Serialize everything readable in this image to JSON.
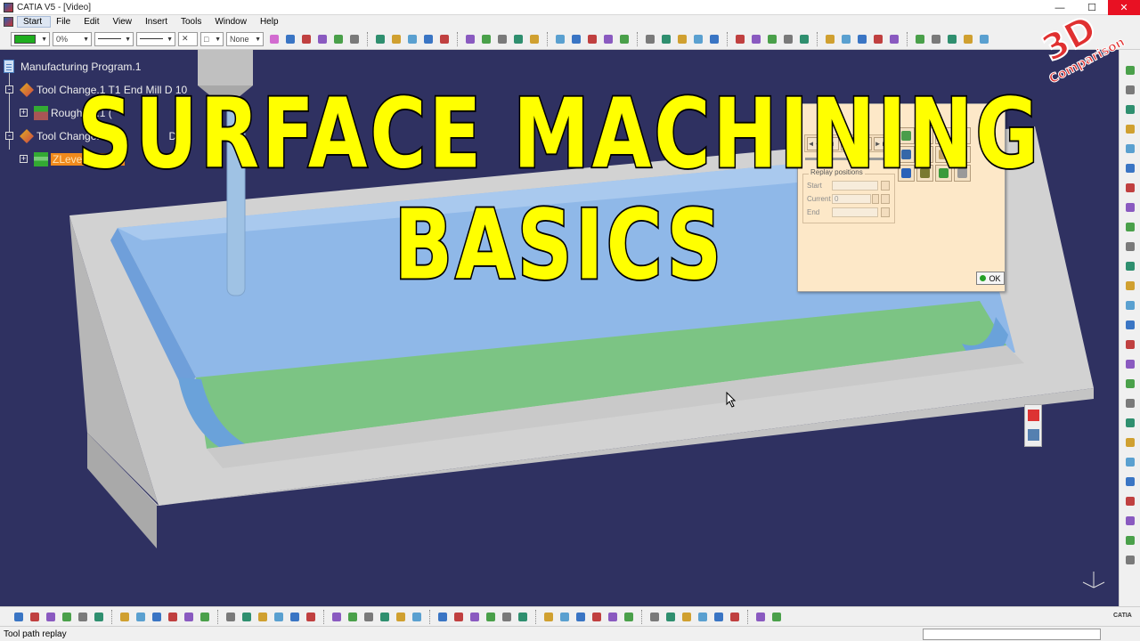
{
  "window": {
    "title": "CATIA V5 - [Video]"
  },
  "menu": [
    "Start",
    "File",
    "Edit",
    "View",
    "Insert",
    "Tools",
    "Window",
    "Help"
  ],
  "toolbar": {
    "transparency": "0%",
    "layer": "None",
    "icon_names": [
      "color-swatch",
      "line-type",
      "line-thickness",
      "point-style",
      "layer",
      "paint-brush",
      "tool-path-icons",
      "machining-operations"
    ]
  },
  "tree": {
    "root": "Manufacturing Program.1",
    "items": [
      {
        "label": "Tool Change.1  T1 End Mill D 10",
        "icon": "tool-change-icon"
      },
      {
        "label": "Roughing.1 (",
        "icon": "roughing-icon"
      },
      {
        "label": "Tool Change.2  T1",
        "suffix": "D",
        "icon": "tool-change-icon"
      },
      {
        "label": "ZLevel.1 (Com",
        "icon": "zlevel-icon",
        "selected": true
      }
    ]
  },
  "headline": {
    "line1": "SURFACE MACHINING",
    "line2": "BASICS"
  },
  "logo": {
    "text1": "3D",
    "text2": "Comparison"
  },
  "dialog": {
    "group_title": "Replay positions",
    "start_label": "Start",
    "current_label": "Current",
    "current_value": "0",
    "end_label": "End",
    "ok_label": "OK"
  },
  "status": {
    "text": "Tool path replay"
  },
  "brand": {
    "text": "CATIA"
  },
  "colors": {
    "background": "#2f3161",
    "stock": "#c8c8c8",
    "pocket_wall": "#7fb0e8",
    "floor": "#7cc484",
    "headline": "#ffff00",
    "selection": "#f08a1c"
  }
}
